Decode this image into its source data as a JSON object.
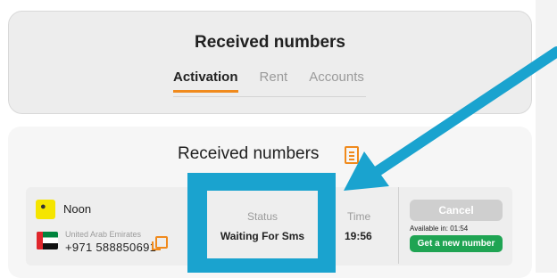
{
  "header": {
    "title": "Received numbers",
    "tabs": [
      {
        "label": "Activation",
        "active": true
      },
      {
        "label": "Rent",
        "active": false
      },
      {
        "label": "Accounts",
        "active": false
      }
    ]
  },
  "section": {
    "title": "Received numbers",
    "icon": "sms-list-icon"
  },
  "row": {
    "service": "Noon",
    "country": "United Arab Emirates",
    "phone": "+971 588850691",
    "status_label": "Status",
    "status_value": "Waiting For Sms",
    "time_label": "Time",
    "time_value": "19:56",
    "cancel_label": "Cancel",
    "available_text": "Available in: 01:54",
    "new_number_label": "Get a new number"
  },
  "colors": {
    "accent": "#f08a1d",
    "highlight": "#1aa3cf",
    "success": "#1fa453",
    "disabled": "#cfcfcf"
  }
}
